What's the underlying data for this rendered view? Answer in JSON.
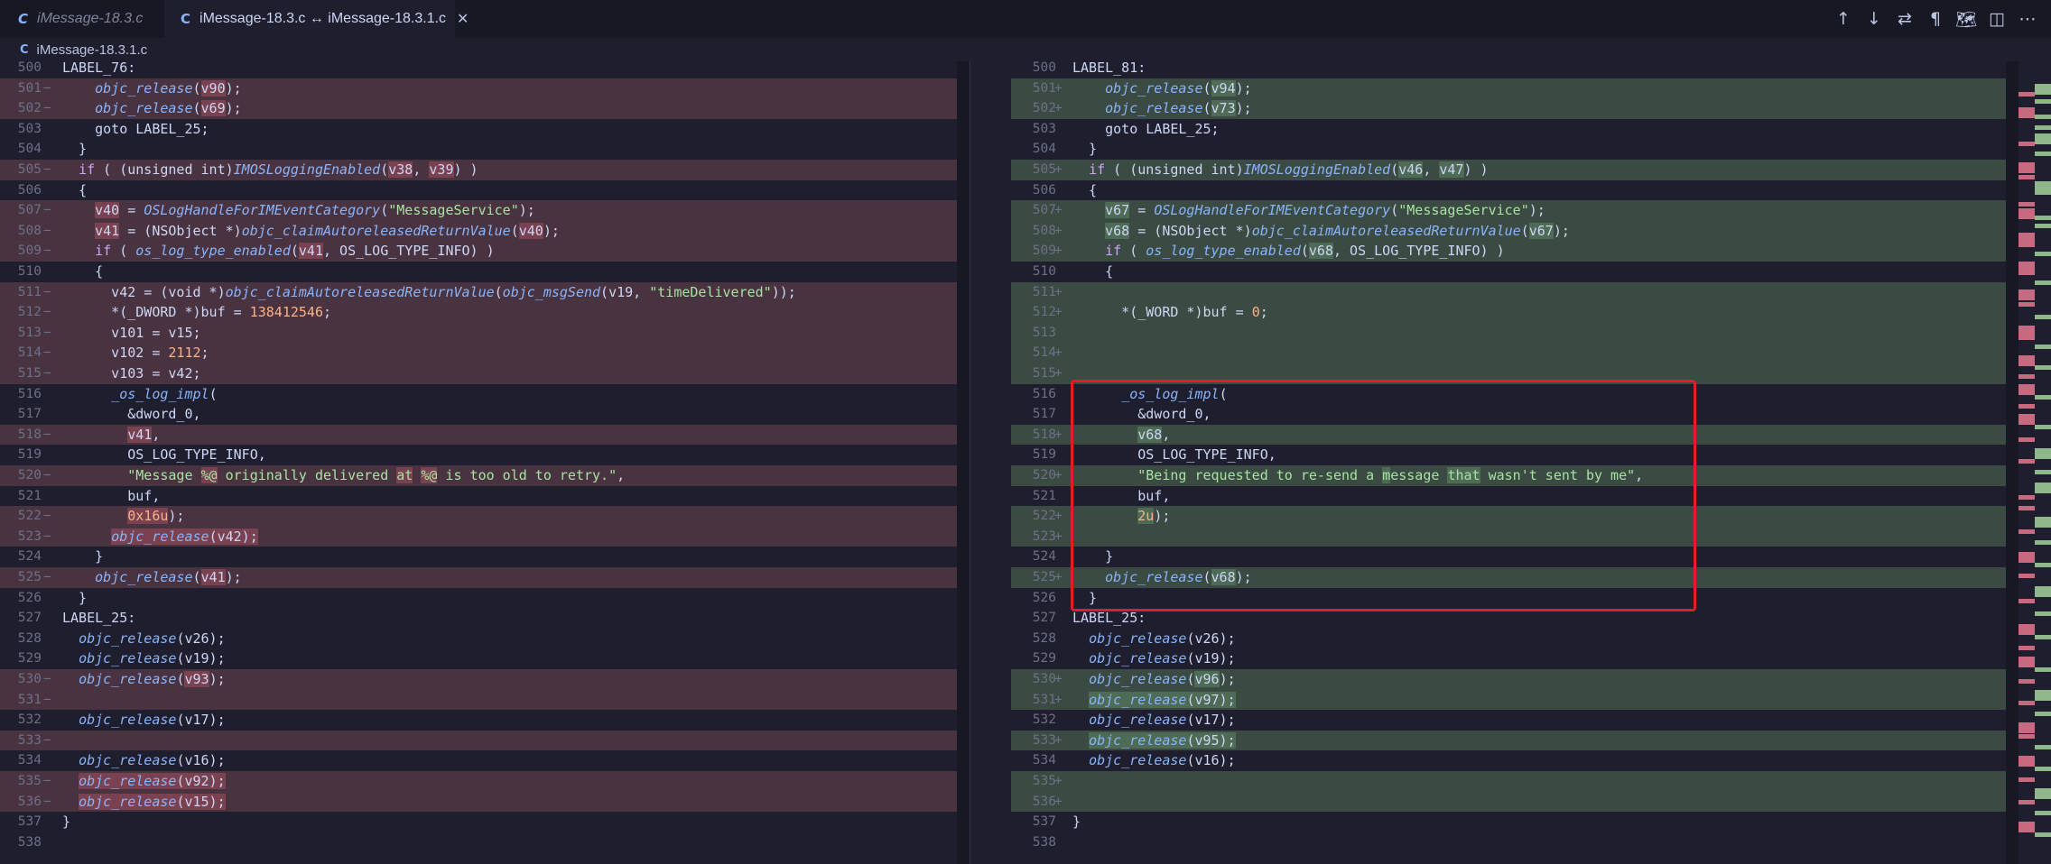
{
  "tabs": [
    {
      "label": "iMessage-18.3.c",
      "active": false,
      "icon": "c-file-icon"
    },
    {
      "label": "iMessage-18.3.c ↔ iMessage-18.3.1.c",
      "active": true,
      "icon": "c-file-icon",
      "close": "✕"
    }
  ],
  "toolbar": {
    "icons": [
      {
        "name": "previous-change-icon",
        "glyph": "↑"
      },
      {
        "name": "next-change-icon",
        "glyph": "↓"
      },
      {
        "name": "swap-sides-icon",
        "glyph": "⇄"
      },
      {
        "name": "whitespace-icon",
        "glyph": "¶"
      },
      {
        "name": "open-map-icon",
        "glyph": "🗺"
      },
      {
        "name": "split-view-icon",
        "glyph": "◫"
      },
      {
        "name": "more-actions-icon",
        "glyph": "⋯"
      }
    ]
  },
  "breadcrumb": {
    "icon": "C",
    "file": "iMessage-18.3.1.c"
  },
  "colors": {
    "deleted_bg": "#4a3340",
    "added_bg": "#3b4a42",
    "highlight": "#e11d2a"
  },
  "left": [
    {
      "n": "500",
      "m": "",
      "bg": "",
      "h": "LABEL_76:"
    },
    {
      "n": "501",
      "m": "−",
      "bg": "del",
      "h": "    <span class='fn'>objc_release</span>(<span class='wd-del'>v90</span>);"
    },
    {
      "n": "502",
      "m": "−",
      "bg": "del",
      "h": "    <span class='fn'>objc_release</span>(<span class='wd-del'>v69</span>);"
    },
    {
      "n": "503",
      "m": "",
      "bg": "",
      "h": "    goto LABEL_25;"
    },
    {
      "n": "504",
      "m": "",
      "bg": "",
      "h": "  }"
    },
    {
      "n": "505",
      "m": "−",
      "bg": "del",
      "h": "  <span class='kw'>if</span> ( (unsigned int)<span class='fn'>IMOSLoggingEnabled</span>(<span class='wd-del'>v38</span>, <span class='wd-del'>v39</span>) )"
    },
    {
      "n": "506",
      "m": "",
      "bg": "",
      "h": "  {"
    },
    {
      "n": "507",
      "m": "−",
      "bg": "del",
      "h": "    <span class='wd-del'>v40</span> = <span class='fn'>OSLogHandleForIMEventCategory</span>(<span class='str'>\"MessageService\"</span>);"
    },
    {
      "n": "508",
      "m": "−",
      "bg": "del",
      "h": "    <span class='wd-del'>v41</span> = (NSObject *)<span class='fn'>objc_claimAutoreleasedReturnValue</span>(<span class='wd-del'>v40</span>);"
    },
    {
      "n": "509",
      "m": "−",
      "bg": "del",
      "h": "    <span class='kw'>if</span> ( <span class='fn'>os_log_type_enabled</span>(<span class='wd-del'>v41</span>, OS_LOG_TYPE_INFO) )"
    },
    {
      "n": "510",
      "m": "",
      "bg": "",
      "h": "    {"
    },
    {
      "n": "511",
      "m": "−",
      "bg": "del",
      "h": "      v42 = (void *)<span class='fn'>objc_claimAutoreleasedReturnValue</span>(<span class='fn'>objc_msgSend</span>(v19, <span class='str'>\"timeDelivered\"</span>));"
    },
    {
      "n": "512",
      "m": "−",
      "bg": "del",
      "h": "      *(_DWORD *)buf = <span class='num'>138412546</span>;"
    },
    {
      "n": "513",
      "m": "−",
      "bg": "del",
      "h": "      v101 = v15;"
    },
    {
      "n": "514",
      "m": "−",
      "bg": "del",
      "h": "      v102 = <span class='num'>2112</span>;"
    },
    {
      "n": "515",
      "m": "−",
      "bg": "del",
      "h": "      v103 = v42;"
    },
    {
      "n": "516",
      "m": "",
      "bg": "",
      "h": "      <span class='fn'>_os_log_impl</span>("
    },
    {
      "n": "517",
      "m": "",
      "bg": "",
      "h": "        &amp;dword_0,"
    },
    {
      "n": "518",
      "m": "−",
      "bg": "del",
      "h": "        <span class='wd-del'>v41</span>,"
    },
    {
      "n": "519",
      "m": "",
      "bg": "",
      "h": "        OS_LOG_TYPE_INFO,"
    },
    {
      "n": "520",
      "m": "−",
      "bg": "del",
      "h": "        <span class='str'>\"Message <span class='wd-del'>%@</span> originally delivered <span class='wd-del'>at</span> <span class='wd-del'>%@</span> is too old to retry.\"</span>,"
    },
    {
      "n": "521",
      "m": "",
      "bg": "",
      "h": "        buf,"
    },
    {
      "n": "522",
      "m": "−",
      "bg": "del",
      "h": "        <span class='num wd-del'>0x16u</span>);"
    },
    {
      "n": "523",
      "m": "−",
      "bg": "del",
      "h": "      <span class='fn wd-del'>objc_release</span><span class='wd-del'>(v42);</span>"
    },
    {
      "n": "524",
      "m": "",
      "bg": "",
      "h": "    }"
    },
    {
      "n": "525",
      "m": "−",
      "bg": "del",
      "h": "    <span class='fn'>objc_release</span>(<span class='wd-del'>v41</span>);"
    },
    {
      "n": "526",
      "m": "",
      "bg": "",
      "h": "  }"
    },
    {
      "n": "527",
      "m": "",
      "bg": "",
      "h": "LABEL_25:"
    },
    {
      "n": "528",
      "m": "",
      "bg": "",
      "h": "  <span class='fn'>objc_release</span>(v26);"
    },
    {
      "n": "529",
      "m": "",
      "bg": "",
      "h": "  <span class='fn'>objc_release</span>(v19);"
    },
    {
      "n": "530",
      "m": "−",
      "bg": "del",
      "h": "  <span class='fn'>objc_release</span>(<span class='wd-del'>v93</span>);"
    },
    {
      "n": "531",
      "m": "−",
      "bg": "del",
      "h": ""
    },
    {
      "n": "532",
      "m": "",
      "bg": "",
      "h": "  <span class='fn'>objc_release</span>(v17);"
    },
    {
      "n": "533",
      "m": "−",
      "bg": "del",
      "h": ""
    },
    {
      "n": "534",
      "m": "",
      "bg": "",
      "h": "  <span class='fn'>objc_release</span>(v16);"
    },
    {
      "n": "535",
      "m": "−",
      "bg": "del",
      "h": "  <span class='fn wd-del'>objc_release</span><span class='wd-del'>(v92);</span>"
    },
    {
      "n": "536",
      "m": "−",
      "bg": "del",
      "h": "  <span class='fn wd-del'>objc_release</span><span class='wd-del'>(v15);</span>"
    },
    {
      "n": "537",
      "m": "",
      "bg": "",
      "h": "}"
    },
    {
      "n": "538",
      "m": "",
      "bg": "",
      "h": ""
    }
  ],
  "right": [
    {
      "n": "500",
      "m": "",
      "bg": "",
      "h": "LABEL_81:"
    },
    {
      "n": "501",
      "m": "+",
      "bg": "add",
      "h": "    <span class='fn'>objc_release</span>(<span class='wd-add'>v94</span>);"
    },
    {
      "n": "502",
      "m": "+",
      "bg": "add",
      "h": "    <span class='fn'>objc_release</span>(<span class='wd-add'>v73</span>);"
    },
    {
      "n": "503",
      "m": "",
      "bg": "",
      "h": "    goto LABEL_25;"
    },
    {
      "n": "504",
      "m": "",
      "bg": "",
      "h": "  }"
    },
    {
      "n": "505",
      "m": "+",
      "bg": "add",
      "h": "  <span class='kw'>if</span> ( (unsigned int)<span class='fn'>IMOSLoggingEnabled</span>(<span class='wd-add'>v46</span>, <span class='wd-add'>v47</span>) )"
    },
    {
      "n": "506",
      "m": "",
      "bg": "",
      "h": "  {"
    },
    {
      "n": "507",
      "m": "+",
      "bg": "add",
      "h": "    <span class='wd-add'>v67</span> = <span class='fn'>OSLogHandleForIMEventCategory</span>(<span class='str'>\"MessageService\"</span>);"
    },
    {
      "n": "508",
      "m": "+",
      "bg": "add",
      "h": "    <span class='wd-add'>v68</span> = (NSObject *)<span class='fn'>objc_claimAutoreleasedReturnValue</span>(<span class='wd-add'>v67</span>);"
    },
    {
      "n": "509",
      "m": "+",
      "bg": "add",
      "h": "    <span class='kw'>if</span> ( <span class='fn'>os_log_type_enabled</span>(<span class='wd-add'>v68</span>, OS_LOG_TYPE_INFO) )"
    },
    {
      "n": "510",
      "m": "",
      "bg": "",
      "h": "    {"
    },
    {
      "n": "511",
      "m": "+",
      "bg": "add",
      "h": ""
    },
    {
      "n": "512",
      "m": "+",
      "bg": "add",
      "h": "      *(_WORD *)buf = <span class='num'>0</span>;"
    },
    {
      "n": "513",
      "m": "",
      "bg": "add",
      "h": ""
    },
    {
      "n": "514",
      "m": "+",
      "bg": "add",
      "h": ""
    },
    {
      "n": "515",
      "m": "+",
      "bg": "add",
      "h": ""
    },
    {
      "n": "516",
      "m": "",
      "bg": "",
      "h": "      <span class='fn'>_os_log_impl</span>("
    },
    {
      "n": "517",
      "m": "",
      "bg": "",
      "h": "        &amp;dword_0,"
    },
    {
      "n": "518",
      "m": "+",
      "bg": "add",
      "h": "        <span class='wd-add'>v68</span>,"
    },
    {
      "n": "519",
      "m": "",
      "bg": "",
      "h": "        OS_LOG_TYPE_INFO,"
    },
    {
      "n": "520",
      "m": "+",
      "bg": "add",
      "h": "        <span class='str'>\"Being requested to re-send a <span class='wd-add'>m</span>essage <span class='wd-add'>that</span> wasn't sent by me\"</span>,"
    },
    {
      "n": "521",
      "m": "",
      "bg": "",
      "h": "        buf,"
    },
    {
      "n": "522",
      "m": "+",
      "bg": "add",
      "h": "        <span class='num wd-add'>2u</span>);"
    },
    {
      "n": "523",
      "m": "+",
      "bg": "add",
      "h": ""
    },
    {
      "n": "524",
      "m": "",
      "bg": "",
      "h": "    }"
    },
    {
      "n": "525",
      "m": "+",
      "bg": "add",
      "h": "    <span class='fn'>objc_release</span>(<span class='wd-add'>v68</span>);"
    },
    {
      "n": "526",
      "m": "",
      "bg": "",
      "h": "  }"
    },
    {
      "n": "527",
      "m": "",
      "bg": "",
      "h": "LABEL_25:"
    },
    {
      "n": "528",
      "m": "",
      "bg": "",
      "h": "  <span class='fn'>objc_release</span>(v26);"
    },
    {
      "n": "529",
      "m": "",
      "bg": "",
      "h": "  <span class='fn'>objc_release</span>(v19);"
    },
    {
      "n": "530",
      "m": "+",
      "bg": "add",
      "h": "  <span class='fn'>objc_release</span>(<span class='wd-add'>v96</span>);"
    },
    {
      "n": "531",
      "m": "+",
      "bg": "add",
      "h": "  <span class='fn wd-add'>objc_release</span><span class='wd-add'>(v97);</span>"
    },
    {
      "n": "532",
      "m": "",
      "bg": "",
      "h": "  <span class='fn'>objc_release</span>(v17);"
    },
    {
      "n": "533",
      "m": "+",
      "bg": "add",
      "h": "  <span class='fn wd-add'>objc_release</span><span class='wd-add'>(v95);</span>"
    },
    {
      "n": "534",
      "m": "",
      "bg": "",
      "h": "  <span class='fn'>objc_release</span>(v16);"
    },
    {
      "n": "535",
      "m": "+",
      "bg": "add",
      "h": ""
    },
    {
      "n": "536",
      "m": "+",
      "bg": "add",
      "h": ""
    },
    {
      "n": "537",
      "m": "",
      "bg": "",
      "h": "}"
    },
    {
      "n": "538",
      "m": "",
      "bg": "",
      "h": ""
    }
  ],
  "overview": [
    {
      "y": 0.022,
      "k": "a"
    },
    {
      "y": 0.032,
      "k": "d"
    },
    {
      "y": 0.041,
      "k": "a"
    },
    {
      "y": 0.052,
      "k": "d"
    },
    {
      "y": 0.061,
      "k": "a"
    },
    {
      "y": 0.075,
      "k": "a"
    },
    {
      "y": 0.085,
      "k": "a"
    },
    {
      "y": 0.095,
      "k": "d"
    },
    {
      "y": 0.108,
      "k": "a"
    },
    {
      "y": 0.122,
      "k": "d"
    },
    {
      "y": 0.13,
      "k": "d"
    },
    {
      "y": 0.138,
      "k": "d"
    },
    {
      "y": 0.146,
      "k": "a"
    },
    {
      "y": 0.158,
      "k": "a"
    },
    {
      "y": 0.172,
      "k": "d"
    },
    {
      "y": 0.18,
      "k": "d"
    },
    {
      "y": 0.19,
      "k": "a"
    },
    {
      "y": 0.2,
      "k": "a"
    },
    {
      "y": 0.212,
      "k": "d"
    },
    {
      "y": 0.224,
      "k": "d"
    },
    {
      "y": 0.236,
      "k": "a"
    },
    {
      "y": 0.248,
      "k": "d"
    },
    {
      "y": 0.26,
      "k": "d"
    },
    {
      "y": 0.272,
      "k": "a"
    },
    {
      "y": 0.284,
      "k": "d"
    },
    {
      "y": 0.3,
      "k": "d"
    },
    {
      "y": 0.316,
      "k": "a"
    },
    {
      "y": 0.33,
      "k": "d"
    },
    {
      "y": 0.342,
      "k": "d"
    },
    {
      "y": 0.354,
      "k": "a"
    },
    {
      "y": 0.368,
      "k": "d"
    },
    {
      "y": 0.38,
      "k": "a"
    },
    {
      "y": 0.392,
      "k": "d"
    },
    {
      "y": 0.405,
      "k": "d"
    },
    {
      "y": 0.418,
      "k": "a"
    },
    {
      "y": 0.43,
      "k": "d"
    },
    {
      "y": 0.442,
      "k": "d"
    },
    {
      "y": 0.456,
      "k": "a"
    },
    {
      "y": 0.472,
      "k": "d"
    },
    {
      "y": 0.486,
      "k": "a"
    },
    {
      "y": 0.5,
      "k": "d"
    },
    {
      "y": 0.514,
      "k": "a"
    },
    {
      "y": 0.53,
      "k": "a"
    },
    {
      "y": 0.546,
      "k": "d"
    },
    {
      "y": 0.56,
      "k": "d"
    },
    {
      "y": 0.574,
      "k": "a"
    },
    {
      "y": 0.59,
      "k": "d"
    },
    {
      "y": 0.604,
      "k": "a"
    },
    {
      "y": 0.618,
      "k": "d"
    },
    {
      "y": 0.632,
      "k": "a"
    },
    {
      "y": 0.646,
      "k": "d"
    },
    {
      "y": 0.662,
      "k": "a"
    },
    {
      "y": 0.678,
      "k": "d"
    },
    {
      "y": 0.694,
      "k": "a"
    },
    {
      "y": 0.71,
      "k": "d"
    },
    {
      "y": 0.724,
      "k": "a"
    },
    {
      "y": 0.738,
      "k": "d"
    },
    {
      "y": 0.752,
      "k": "d"
    },
    {
      "y": 0.766,
      "k": "a"
    },
    {
      "y": 0.78,
      "k": "d"
    },
    {
      "y": 0.794,
      "k": "a"
    },
    {
      "y": 0.808,
      "k": "d"
    },
    {
      "y": 0.822,
      "k": "a"
    },
    {
      "y": 0.836,
      "k": "d"
    },
    {
      "y": 0.85,
      "k": "d"
    },
    {
      "y": 0.864,
      "k": "a"
    },
    {
      "y": 0.878,
      "k": "d"
    },
    {
      "y": 0.892,
      "k": "a"
    },
    {
      "y": 0.906,
      "k": "d"
    },
    {
      "y": 0.92,
      "k": "a"
    },
    {
      "y": 0.934,
      "k": "d"
    },
    {
      "y": 0.948,
      "k": "a"
    },
    {
      "y": 0.962,
      "k": "d"
    },
    {
      "y": 0.976,
      "k": "a"
    }
  ]
}
